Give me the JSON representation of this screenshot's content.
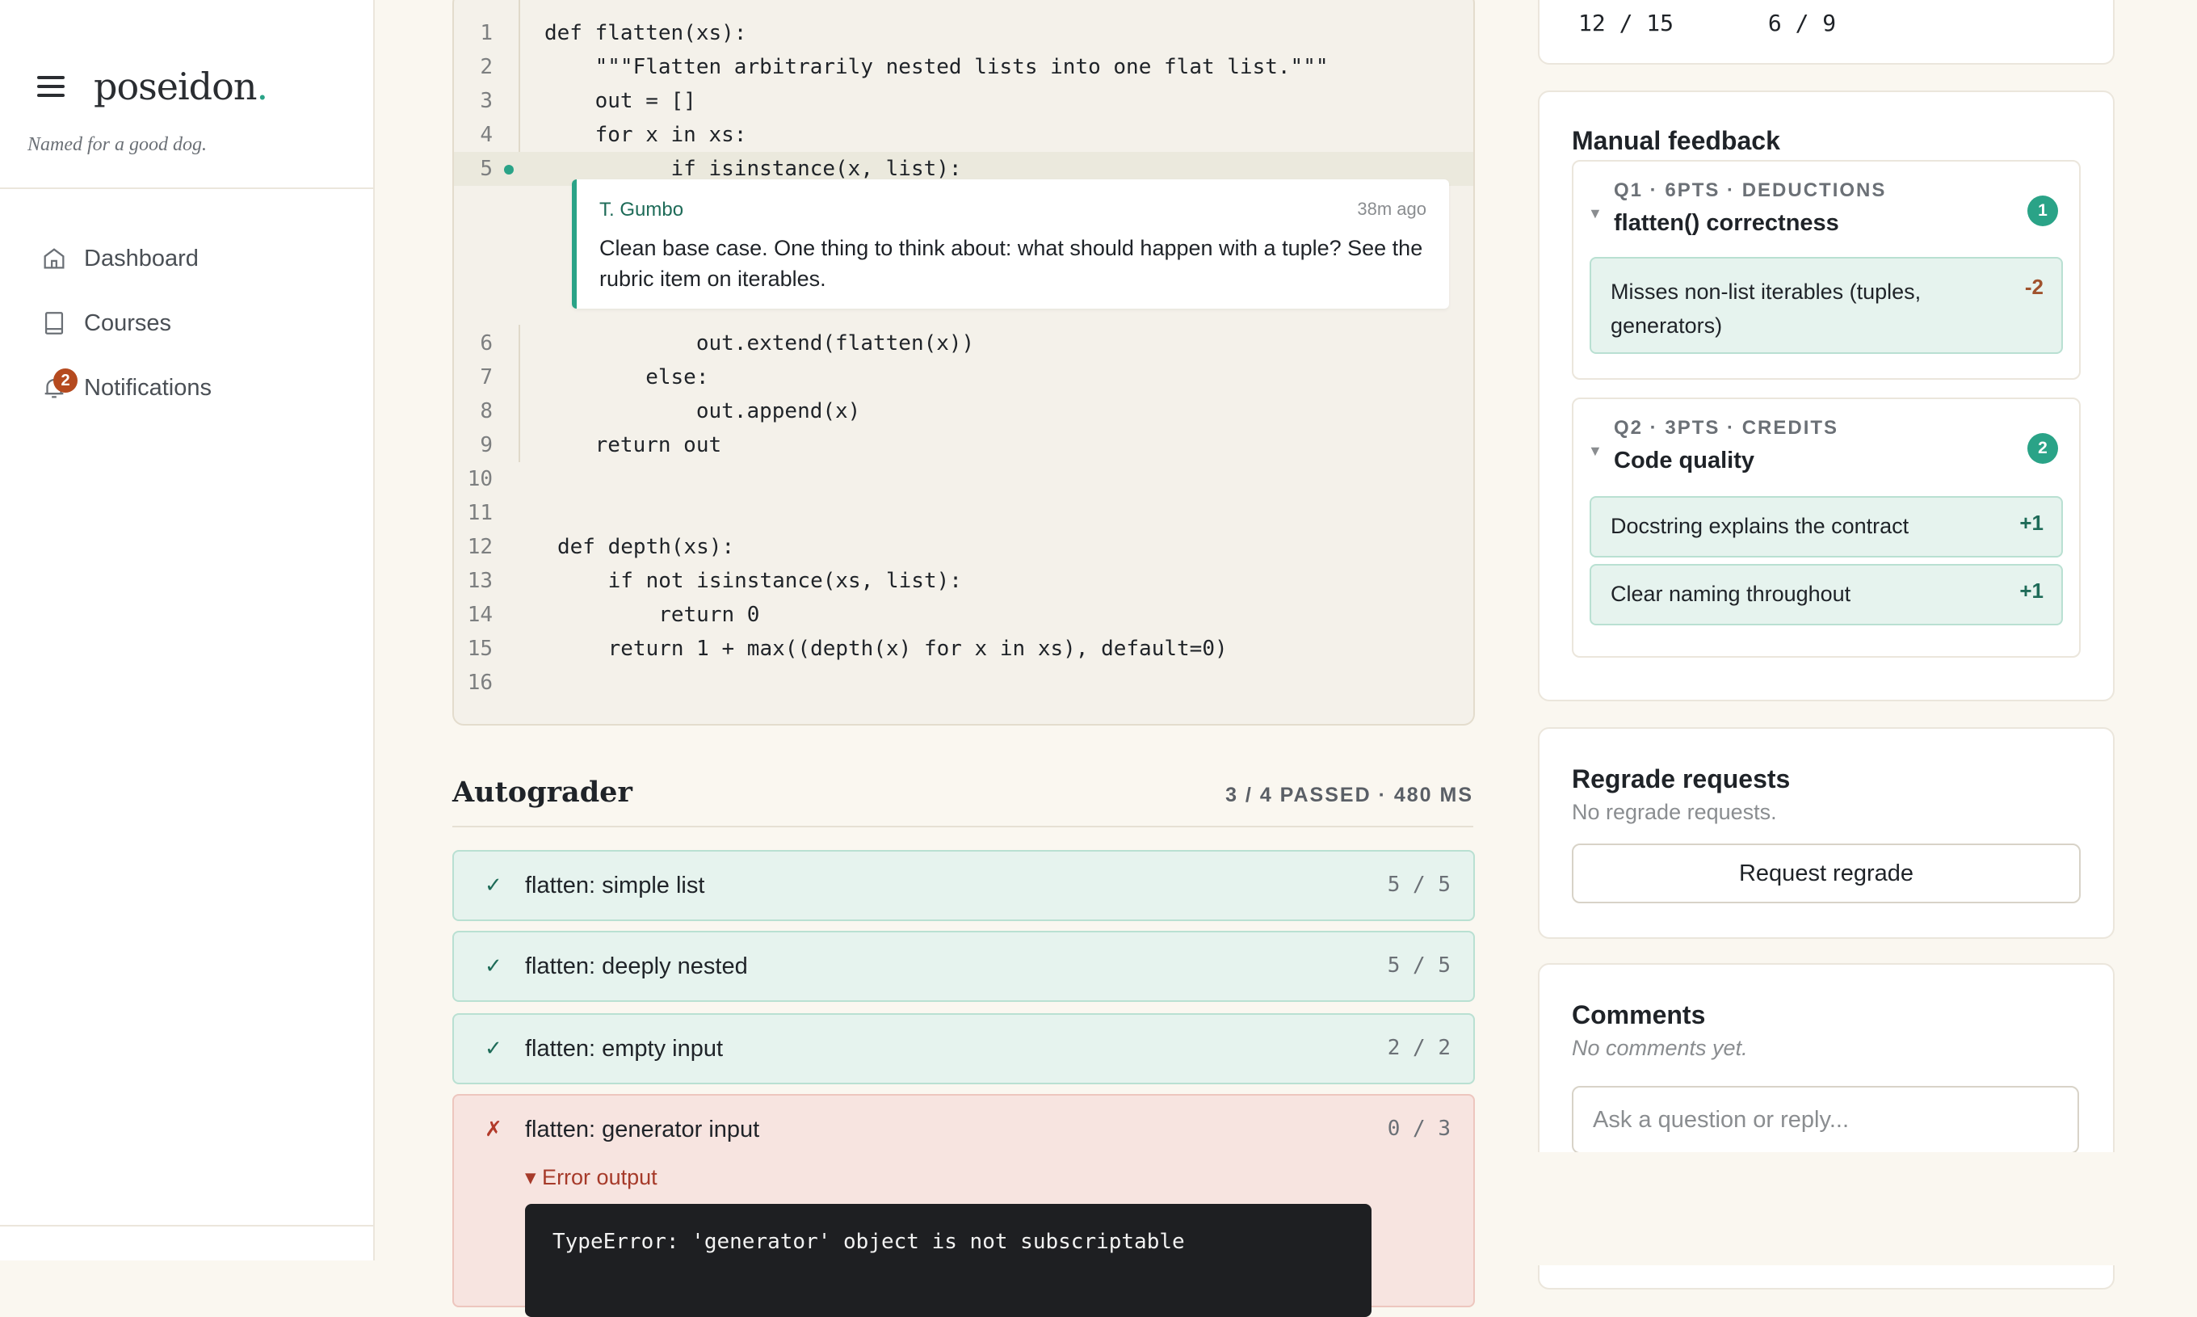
{
  "app": {
    "logo": "poseidon",
    "logo_dot": ".",
    "tagline": "Named for a good dog."
  },
  "nav": [
    {
      "label": "Dashboard",
      "icon": "home-icon"
    },
    {
      "label": "Courses",
      "icon": "book-icon"
    },
    {
      "label": "Notifications",
      "icon": "bell-icon",
      "badge": "2"
    }
  ],
  "code": {
    "lines_a": [
      {
        "n": "1",
        "text": "def flatten(xs):"
      },
      {
        "n": "2",
        "text": "    \"\"\"Flatten arbitrarily nested lists into one flat list.\"\"\""
      },
      {
        "n": "3",
        "text": "    out = []"
      },
      {
        "n": "4",
        "text": "    for x in xs:"
      },
      {
        "n": "5",
        "text": "          if isinstance(x, list):"
      }
    ],
    "comment": {
      "author": "T. Gumbo",
      "time": "38m ago",
      "text": "Clean base case. One thing to think about: what should happen with a tuple? See the rubric item on iterables."
    },
    "lines_b": [
      {
        "n": "6",
        "text": "            out.extend(flatten(x))"
      },
      {
        "n": "7",
        "text": "        else:"
      },
      {
        "n": "8",
        "text": "            out.append(x)"
      },
      {
        "n": "9",
        "text": "    return out"
      },
      {
        "n": "10",
        "text": ""
      },
      {
        "n": "11",
        "text": ""
      },
      {
        "n": "12",
        "text": "def depth(xs):"
      },
      {
        "n": "13",
        "text": "    if not isinstance(xs, list):"
      },
      {
        "n": "14",
        "text": "        return 0"
      },
      {
        "n": "15",
        "text": "    return 1 + max((depth(x) for x in xs), default=0)"
      },
      {
        "n": "16",
        "text": ""
      }
    ]
  },
  "autograder": {
    "title": "Autograder",
    "summary": "3 / 4 PASSED · 480 MS",
    "tests": [
      {
        "mark": "✓",
        "name": "flatten: simple list",
        "score": "5 / 5"
      },
      {
        "mark": "✓",
        "name": "flatten: deeply nested",
        "score": "5 / 5"
      },
      {
        "mark": "✓",
        "name": "flatten: empty input",
        "score": "2 / 2"
      },
      {
        "mark": "✗",
        "name": "flatten: generator input",
        "score": "0 / 3"
      }
    ],
    "error_toggle": "▾ Error output",
    "error_text": "TypeError: 'generator' object is not subscriptable"
  },
  "scores": {
    "left": "12 / 15",
    "right": "6 / 9"
  },
  "manual": {
    "title": "Manual feedback",
    "questions": [
      {
        "label": "Q1 · 6PTS · DEDUCTIONS",
        "title": "flatten() correctness",
        "count": "1",
        "items": [
          {
            "text": "Misses non-list iterables (tuples, generators)",
            "pts": "-2"
          }
        ]
      },
      {
        "label": "Q2 · 3PTS · CREDITS",
        "title": "Code quality",
        "count": "2",
        "items": [
          {
            "text": "Docstring explains the contract",
            "pts": "+1"
          },
          {
            "text": "Clear naming throughout",
            "pts": "+1"
          }
        ]
      }
    ]
  },
  "regrade": {
    "title": "Regrade requests",
    "sub": "No regrade requests.",
    "button": "Request regrade"
  },
  "comments": {
    "title": "Comments",
    "sub": "No comments yet.",
    "placeholder": "Ask a question or reply..."
  },
  "colors": {
    "accent": "#2aa387",
    "pass_bg": "#e6f3ee",
    "fail_bg": "#f7e4e0",
    "badge": "#b54a1f"
  }
}
